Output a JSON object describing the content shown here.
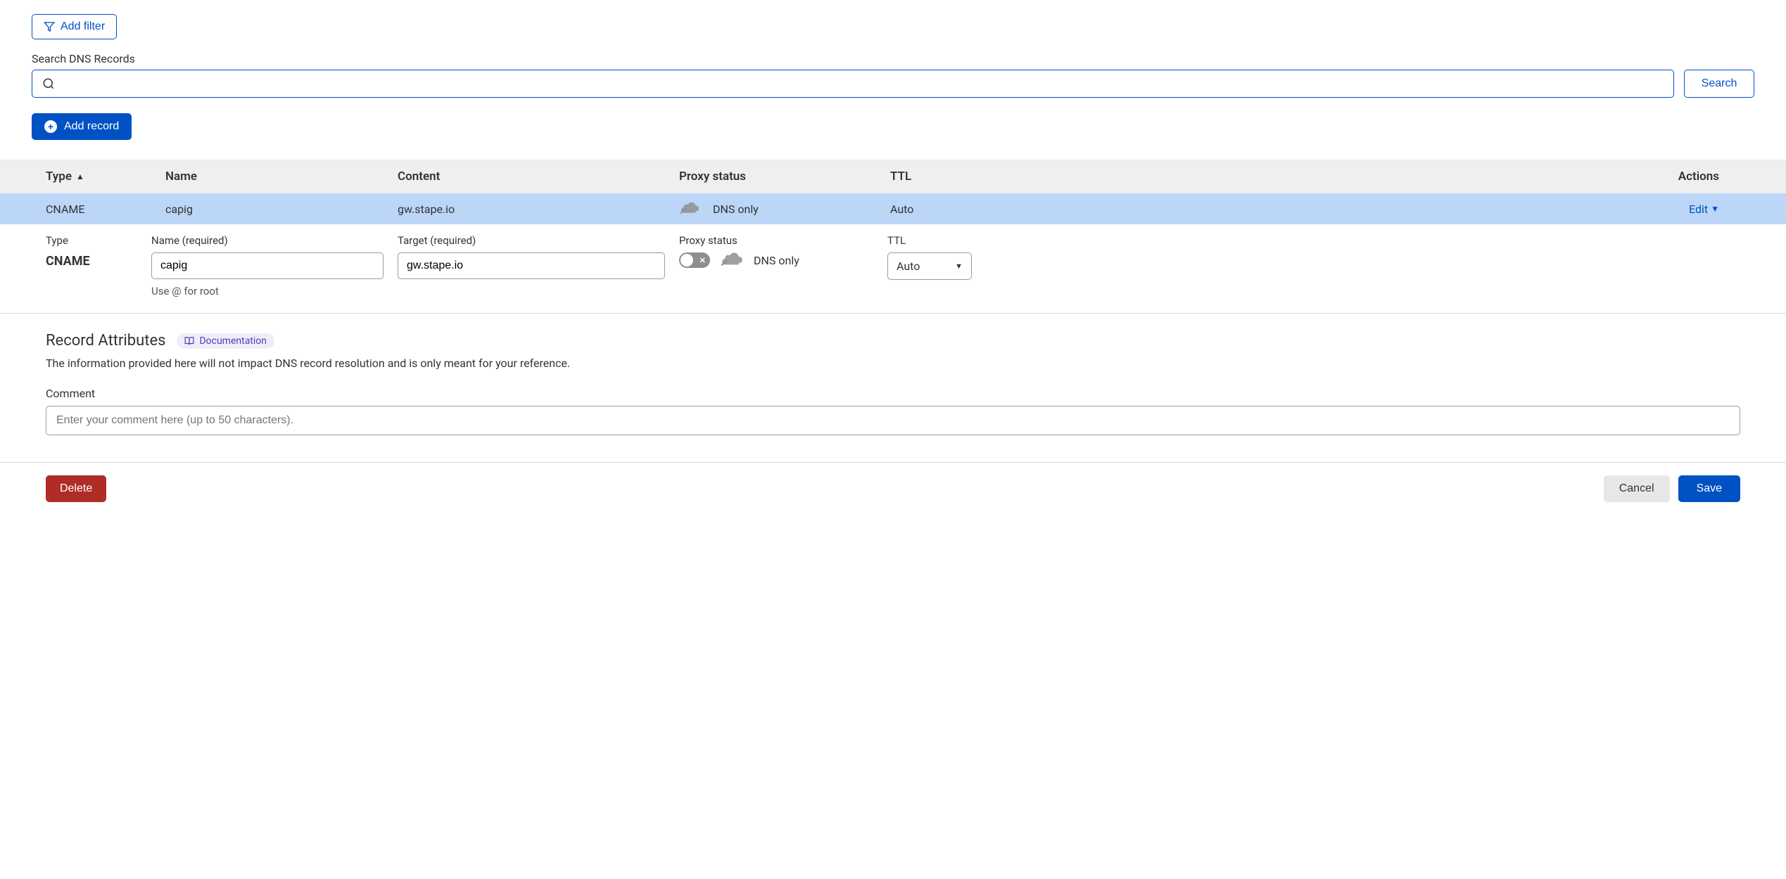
{
  "toolbar": {
    "add_filter_label": "Add filter",
    "search_label": "Search DNS Records",
    "search_button": "Search",
    "add_record_label": "Add record"
  },
  "table": {
    "headers": {
      "type": "Type",
      "name": "Name",
      "content": "Content",
      "proxy": "Proxy status",
      "ttl": "TTL",
      "actions": "Actions"
    },
    "rows": [
      {
        "type": "CNAME",
        "name": "capig",
        "content": "gw.stape.io",
        "proxy": "DNS only",
        "ttl": "Auto",
        "action": "Edit"
      }
    ]
  },
  "edit_form": {
    "type_label": "Type",
    "type_value": "CNAME",
    "name_label": "Name (required)",
    "name_value": "capig",
    "name_help": "Use @ for root",
    "target_label": "Target (required)",
    "target_value": "gw.stape.io",
    "proxy_label": "Proxy status",
    "proxy_value": "DNS only",
    "ttl_label": "TTL",
    "ttl_value": "Auto"
  },
  "attributes": {
    "title": "Record Attributes",
    "doc_link": "Documentation",
    "description": "The information provided here will not impact DNS record resolution and is only meant for your reference.",
    "comment_label": "Comment",
    "comment_placeholder": "Enter your comment here (up to 50 characters)."
  },
  "actions": {
    "delete": "Delete",
    "cancel": "Cancel",
    "save": "Save"
  }
}
